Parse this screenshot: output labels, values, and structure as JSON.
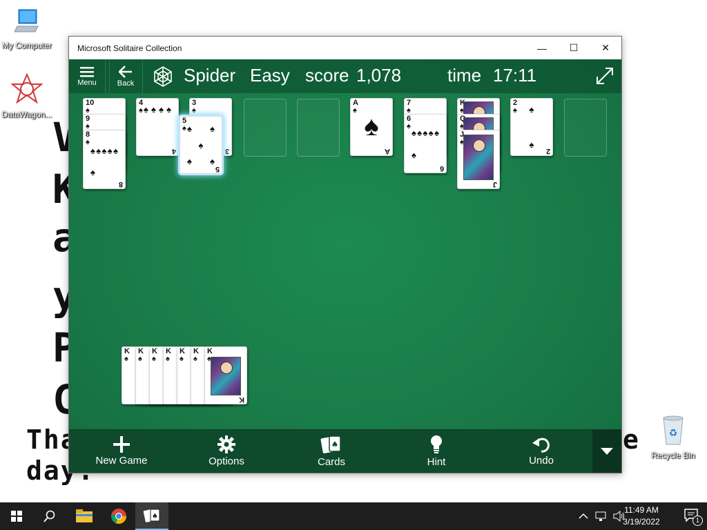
{
  "desktop": {
    "icons": [
      {
        "label": "My Computer"
      },
      {
        "label": "DataWagon..."
      },
      {
        "label": "Recycle Bin"
      }
    ],
    "background_text": {
      "line1": "Tha",
      "line2": "day.",
      "right_fragment": "e",
      "letters": [
        "V",
        "K",
        "a",
        "y",
        "P",
        "C"
      ]
    }
  },
  "window": {
    "title": "Microsoft Solitaire Collection",
    "controls": {
      "minimize": "—",
      "maximize": "☐",
      "close": "✕"
    }
  },
  "game": {
    "menu_label": "Menu",
    "back_label": "Back",
    "game_name": "Spider",
    "difficulty": "Easy",
    "score_label": "score",
    "score_value": "1,078",
    "time_label": "time",
    "time_value": "17:11",
    "suit_symbol": "♠",
    "columns": [
      {
        "cards": [
          "10",
          "9",
          "8"
        ]
      },
      {
        "cards": [
          "4"
        ]
      },
      {
        "cards": [
          "3",
          "5"
        ]
      },
      {
        "cards": []
      },
      {
        "cards": []
      },
      {
        "cards": [
          "A"
        ]
      },
      {
        "cards": [
          "7",
          "6"
        ]
      },
      {
        "cards": [
          "K",
          "Q",
          "J"
        ]
      },
      {
        "cards": [
          "2"
        ]
      },
      {
        "cards": []
      }
    ],
    "completed_stack": {
      "cards": [
        "K",
        "K",
        "K",
        "K",
        "K",
        "K",
        "K"
      ]
    }
  },
  "bottombar": {
    "new_game": "New Game",
    "options": "Options",
    "cards": "Cards",
    "hint": "Hint",
    "undo": "Undo"
  },
  "taskbar": {
    "time": "11:49 AM",
    "date": "3/19/2022",
    "notification_count": "1"
  },
  "colors": {
    "felt": "#1f7b4d",
    "bar": "#0f4a2d",
    "selection_glow": "#7fd6ff"
  }
}
